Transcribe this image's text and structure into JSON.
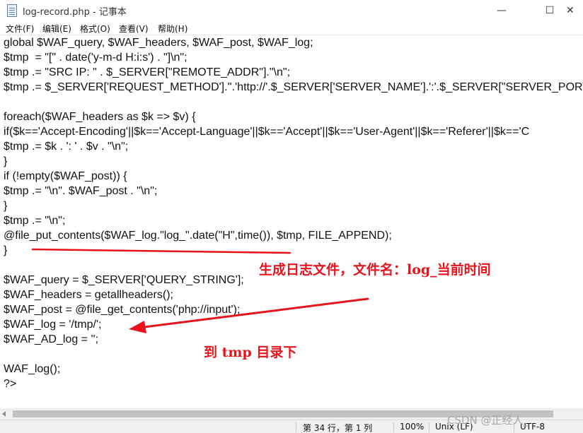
{
  "window": {
    "title": "log-record.php - 记事本",
    "minimize_glyph": "—",
    "maximize_glyph": "☐",
    "close_glyph": "✕"
  },
  "menu": {
    "items": [
      "文件(F)",
      "编辑(E)",
      "格式(O)",
      "查看(V)",
      "帮助(H)"
    ]
  },
  "code": {
    "lines": [
      "global $WAF_query, $WAF_headers, $WAF_post, $WAF_log;",
      "$tmp  = \"[\" . date('y-m-d H:i:s') . \"]\\n\";",
      "$tmp .= \"SRC IP: \" . $_SERVER[\"REMOTE_ADDR\"].\"\\n\";",
      "$tmp .= $_SERVER['REQUEST_METHOD'].''.'http://'.$_SERVER['SERVER_NAME'].':'.$_SERVER[\"SERVER_PORT\"].",
      "",
      "foreach($WAF_headers as $k => $v) {",
      "if($k=='Accept-Encoding'||$k=='Accept-Language'||$k=='Accept'||$k=='User-Agent'||$k=='Referer'||$k=='C",
      "$tmp .= $k . ': ' . $v . \"\\n\";",
      "}",
      "if (!empty($WAF_post)) {",
      "$tmp .= \"\\n\". $WAF_post . \"\\n\";",
      "}",
      "$tmp .= \"\\n\";",
      "@file_put_contents($WAF_log.\"log_\".date(\"H\",time()), $tmp, FILE_APPEND);",
      "}",
      "",
      "$WAF_query = $_SERVER['QUERY_STRING'];",
      "$WAF_headers = getallheaders();",
      "$WAF_post = @file_get_contents('php://input');",
      "$WAF_log = '/tmp/';",
      "$WAF_AD_log = '';",
      "",
      "WAF_log();",
      "?>"
    ]
  },
  "annotations": {
    "note_log_file": "生成日志文件，文件名：log_当前时间",
    "note_tmp_dir": "到 tmp 目录下",
    "color": "#e8131c"
  },
  "status": {
    "position": "第 34 行，第 1 列",
    "zoom": "100%",
    "line_ending": "Unix (LF)",
    "encoding": "UTF-8"
  },
  "watermark": "CSDN @正经人_"
}
